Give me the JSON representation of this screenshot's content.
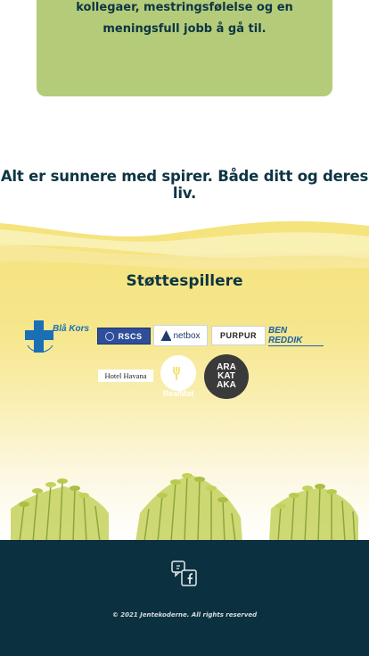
{
  "intro_card": {
    "text": "kollegaer, mestringsfølelse og en meningsfull jobb å gå til."
  },
  "slogan": "Alt er sunnere med spirer. Både ditt og deres liv.",
  "supporters": {
    "title": "Støttespillere",
    "logos": [
      {
        "name": "Blå Kors",
        "text": "Blå Kors"
      },
      {
        "name": "RSCS",
        "text": "RSCS"
      },
      {
        "name": "netbox",
        "text": "netbox"
      },
      {
        "name": "Purpur",
        "text": "PURPUR"
      },
      {
        "name": "Ben Reddik",
        "text": "BEN REDDIK"
      },
      {
        "name": "Hotel Havana",
        "text": "Hotel Havana"
      },
      {
        "name": "RealMat",
        "text": "RealMat"
      },
      {
        "name": "Arakataka",
        "line1": "ARA",
        "line2": "KAT",
        "line3": "AKA"
      }
    ]
  },
  "footer": {
    "icon": "facebook-chat-icon",
    "copyright": "© 2021 Jentekoderne. All rights reserved"
  },
  "colors": {
    "primary_text": "#0d3543",
    "card_green": "#b4cc7a",
    "yellow": "#f5e37a",
    "footer_bg": "#0b3140",
    "blaa_kors": "#1a6fb5",
    "rscs": "#2f4e9a"
  }
}
